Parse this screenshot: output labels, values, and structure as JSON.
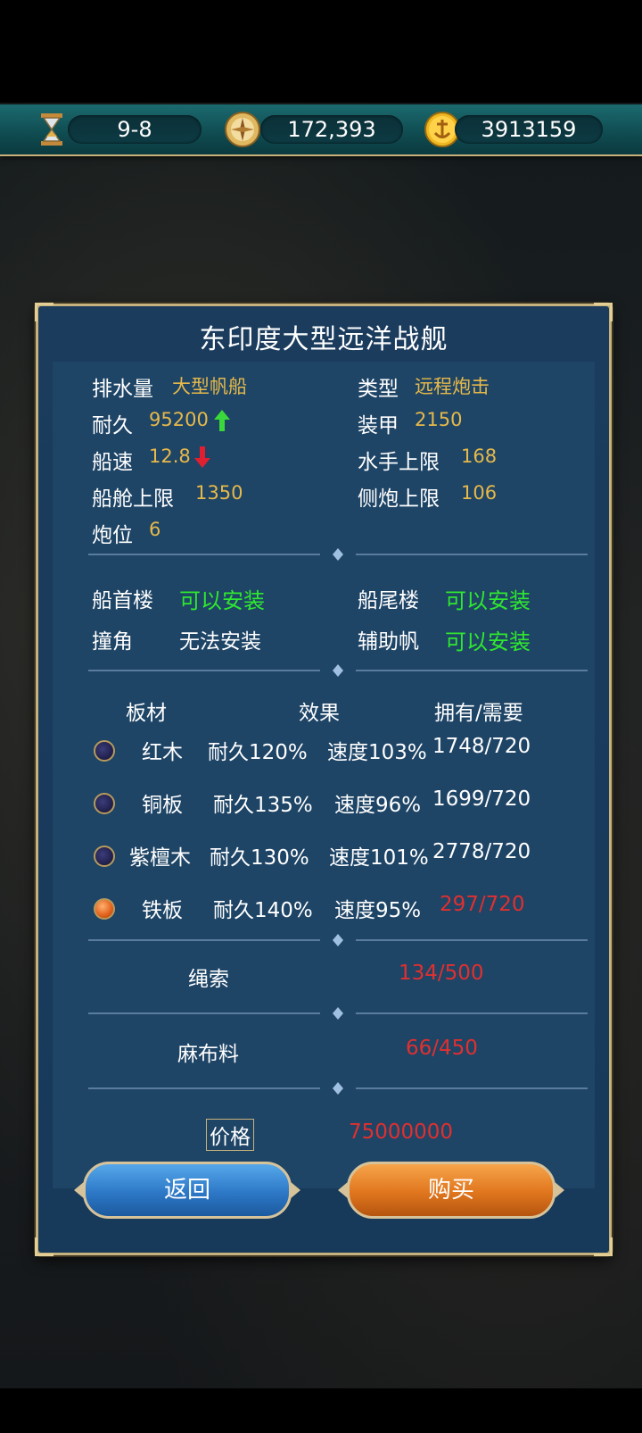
{
  "topbar": {
    "stage": "9-8",
    "currency1": "172,393",
    "currency2": "3913159"
  },
  "dialog": {
    "title": "东印度大型远洋战舰",
    "stats": {
      "displacement_label": "排水量",
      "displacement_value": "大型帆船",
      "type_label": "类型",
      "type_value": "远程炮击",
      "durability_label": "耐久",
      "durability_value": "95200",
      "armor_label": "装甲",
      "armor_value": "2150",
      "speed_label": "船速",
      "speed_value": "12.8",
      "sailors_label": "水手上限",
      "sailors_value": "168",
      "cabin_label": "船舱上限",
      "cabin_value": "1350",
      "sidegun_label": "侧炮上限",
      "sidegun_value": "106",
      "gunslot_label": "炮位",
      "gunslot_value": "6"
    },
    "install": {
      "bow_label": "船首楼",
      "bow_value": "可以安装",
      "stern_label": "船尾楼",
      "stern_value": "可以安装",
      "ram_label": "撞角",
      "ram_value": "无法安装",
      "aux_label": "辅助帆",
      "aux_value": "可以安装"
    },
    "materials": {
      "headers": [
        "板材",
        "效果",
        "拥有/需要"
      ],
      "rows": [
        {
          "name": "红木",
          "durability": "耐久120%",
          "speed": "速度103%",
          "have": "1748/720",
          "selected": false,
          "enough": true
        },
        {
          "name": "铜板",
          "durability": "耐久135%",
          "speed": "速度96%",
          "have": "1699/720",
          "selected": false,
          "enough": true
        },
        {
          "name": "紫檀木",
          "durability": "耐久130%",
          "speed": "速度101%",
          "have": "2778/720",
          "selected": false,
          "enough": true
        },
        {
          "name": "铁板",
          "durability": "耐久140%",
          "speed": "速度95%",
          "have": "297/720",
          "selected": true,
          "enough": false
        }
      ]
    },
    "rope": {
      "label": "绳索",
      "value": "134/500"
    },
    "linen": {
      "label": "麻布料",
      "value": "66/450"
    },
    "price": {
      "label": "价格",
      "value": "75000000"
    },
    "buttons": {
      "back": "返回",
      "buy": "购买"
    },
    "colors": {
      "gold": "#e6b94a",
      "green": "#2fe82f",
      "red": "#e03030",
      "panel": "#1e4466"
    }
  }
}
